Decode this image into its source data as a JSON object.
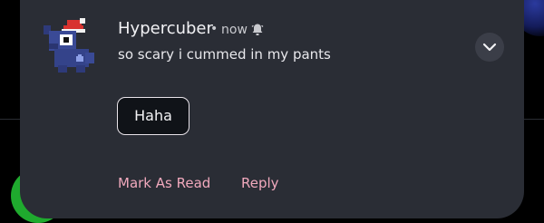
{
  "notification": {
    "app_name": "Hypercuber",
    "separator": "•",
    "time": "now",
    "message": "so scary i cummed in my pants",
    "smart_reply": "Haha",
    "actions": [
      "Mark As Read",
      "Reply"
    ],
    "icons": {
      "avatar": "pixel-art-character-avatar",
      "bell": "bell-alert-icon",
      "expand": "chevron-down-icon"
    }
  },
  "colors": {
    "card_background": "#2a2d35",
    "action_text": "#f1a9bd",
    "chip_border": "#e9e4ea"
  }
}
